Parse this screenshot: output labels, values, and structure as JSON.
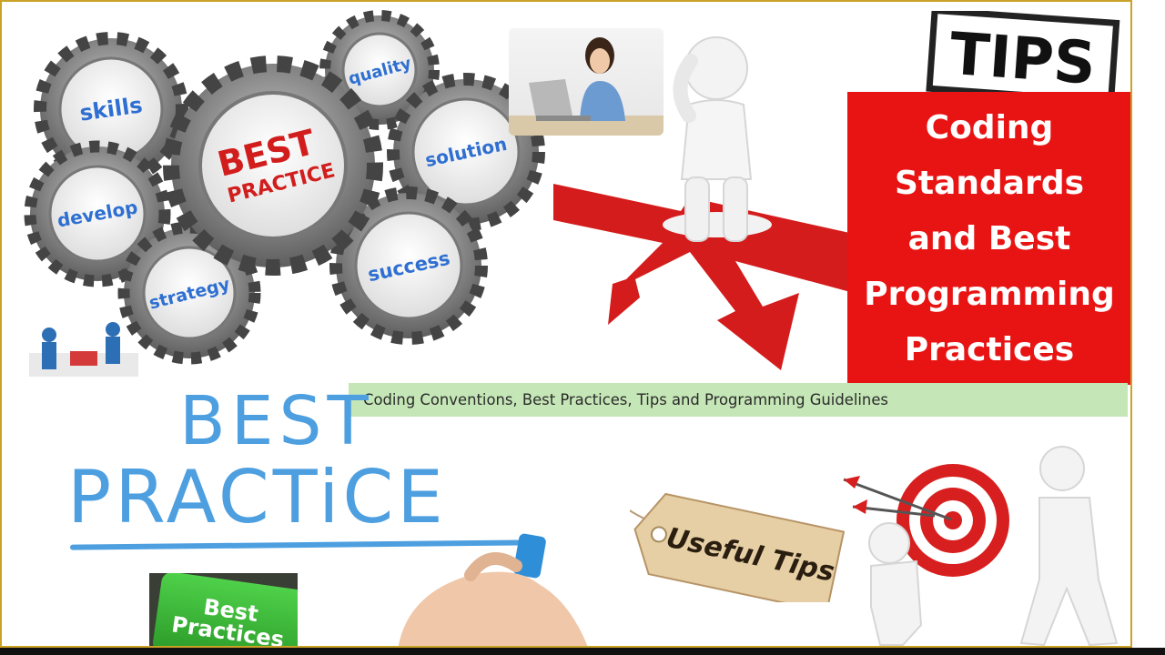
{
  "gears": {
    "center": {
      "line1": "BEST",
      "line2": "PRACTICE"
    },
    "labels": [
      "skills",
      "quality",
      "solution",
      "develop",
      "strategy",
      "success"
    ]
  },
  "title_box": {
    "text": "Coding\nStandards\nand Best\nProgramming\nPractices"
  },
  "strip": {
    "text": "Coding Conventions, Best Practices, Tips and Programming Guidelines"
  },
  "tips_stamp": {
    "text": "TIPS"
  },
  "best_practice": {
    "best": "BEST",
    "practice": "PRACTiCE"
  },
  "key": {
    "line1": "Best",
    "line2": "Practices"
  },
  "tag": {
    "text": "Useful Tips"
  },
  "colors": {
    "red": "#e81414",
    "blue_text": "#4d9fe0",
    "green_strip": "#c5e6b6",
    "border": "#c9a227"
  }
}
